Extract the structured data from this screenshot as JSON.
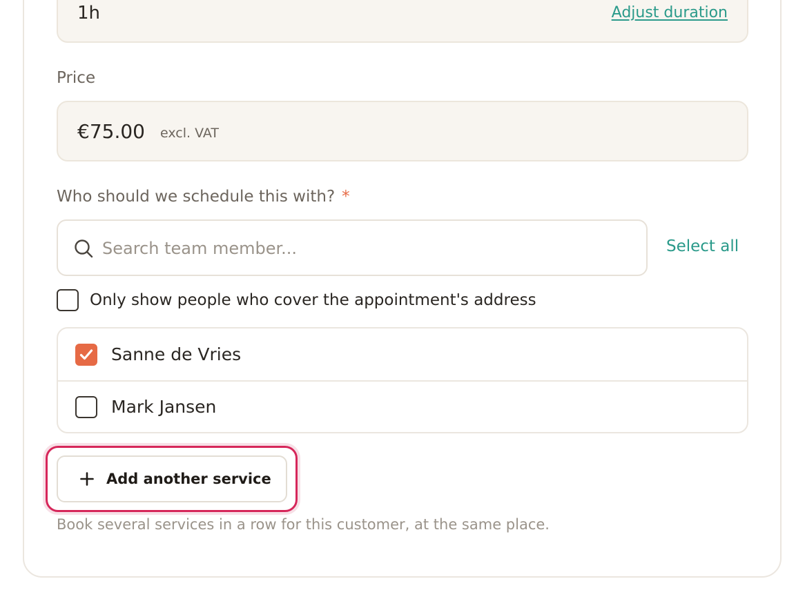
{
  "duration": {
    "value": "1h",
    "adjust_label": "Adjust duration"
  },
  "price": {
    "label": "Price",
    "value": "€75.00",
    "suffix": "excl. VAT"
  },
  "schedule": {
    "label": "Who should we schedule this with?",
    "required_marker": "*",
    "search_placeholder": "Search team member...",
    "select_all_label": "Select all",
    "filter_label": "Only show people who cover the appointment's address",
    "filter_checked": false,
    "members": [
      {
        "name": "Sanne de Vries",
        "checked": true
      },
      {
        "name": "Mark Jansen",
        "checked": false
      }
    ]
  },
  "add_service": {
    "label": "Add another service",
    "icon": "plus-icon",
    "helper": "Book several services in a row for this customer, at the same place."
  },
  "colors": {
    "accent": "#2a9a8a",
    "checkbox_checked": "#e66a45",
    "required": "#e66a45",
    "focus_ring": "#d6265a"
  }
}
